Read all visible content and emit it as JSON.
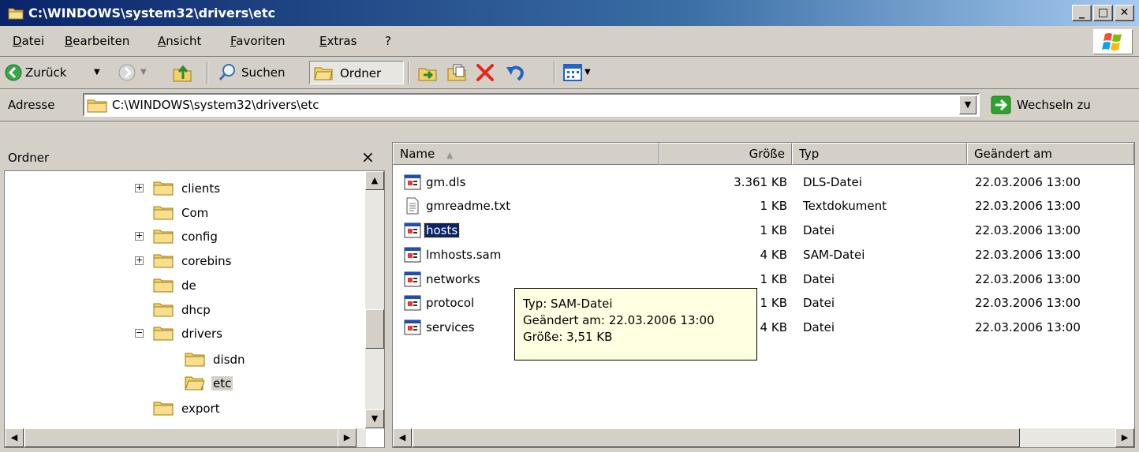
{
  "window": {
    "title": "C:\\WINDOWS\\system32\\drivers\\etc",
    "controls": {
      "minimize": "_",
      "maximize": "□",
      "close": "✕"
    }
  },
  "menu": [
    "Datei",
    "Bearbeiten",
    "Ansicht",
    "Favoriten",
    "Extras",
    "?"
  ],
  "toolbar": {
    "back_label": "Zurück",
    "search_label": "Suchen",
    "folders_label": "Ordner"
  },
  "address": {
    "label": "Adresse",
    "value": "C:\\WINDOWS\\system32\\drivers\\etc",
    "go_label": "Wechseln zu"
  },
  "folder_pane": {
    "title": "Ordner",
    "close": "×",
    "items": [
      {
        "label": "clients",
        "expander": "+"
      },
      {
        "label": "Com",
        "expander": ""
      },
      {
        "label": "config",
        "expander": "+"
      },
      {
        "label": "corebins",
        "expander": "+"
      },
      {
        "label": "de",
        "expander": ""
      },
      {
        "label": "dhcp",
        "expander": ""
      },
      {
        "label": "drivers",
        "expander": "−"
      },
      {
        "label": "disdn",
        "expander": ""
      },
      {
        "label": "etc",
        "expander": ""
      },
      {
        "label": "export",
        "expander": ""
      }
    ]
  },
  "file_list": {
    "columns": {
      "name": "Name",
      "size": "Größe",
      "type": "Typ",
      "modified": "Geändert am"
    },
    "rows": [
      {
        "name": "gm.dls",
        "size": "3.361 KB",
        "type": "DLS-Datei",
        "modified": "22.03.2006 13:00",
        "icon": "system-file-icon"
      },
      {
        "name": "gmreadme.txt",
        "size": "1 KB",
        "type": "Textdokument",
        "modified": "22.03.2006 13:00",
        "icon": "text-file-icon"
      },
      {
        "name": "hosts",
        "size": "1 KB",
        "type": "Datei",
        "modified": "22.03.2006 13:00",
        "icon": "system-file-icon"
      },
      {
        "name": "lmhosts.sam",
        "size": "4 KB",
        "type": "SAM-Datei",
        "modified": "22.03.2006 13:00",
        "icon": "system-file-icon"
      },
      {
        "name": "networks",
        "size": "1 KB",
        "type": "Datei",
        "modified": "22.03.2006 13:00",
        "icon": "system-file-icon"
      },
      {
        "name": "protocol",
        "size": "1 KB",
        "type": "Datei",
        "modified": "22.03.2006 13:00",
        "icon": "system-file-icon"
      },
      {
        "name": "services",
        "size": "4 KB",
        "type": "Datei",
        "modified": "22.03.2006 13:00",
        "icon": "system-file-icon"
      }
    ],
    "selected": "hosts"
  },
  "tooltip": {
    "type": "Typ: SAM-Datei",
    "modified": "Geändert am: 22.03.2006 13:00",
    "size": "Größe: 3,51 KB"
  },
  "colors": {
    "title_start": "#0a246a",
    "title_end": "#a6caf0",
    "chrome": "#d4d0c8",
    "selection": "#0a246a",
    "tooltip_bg": "#ffffe1",
    "folder_yellow": "#f2d16b",
    "delete_red": "#e8261b",
    "go_green": "#2aa52a"
  }
}
